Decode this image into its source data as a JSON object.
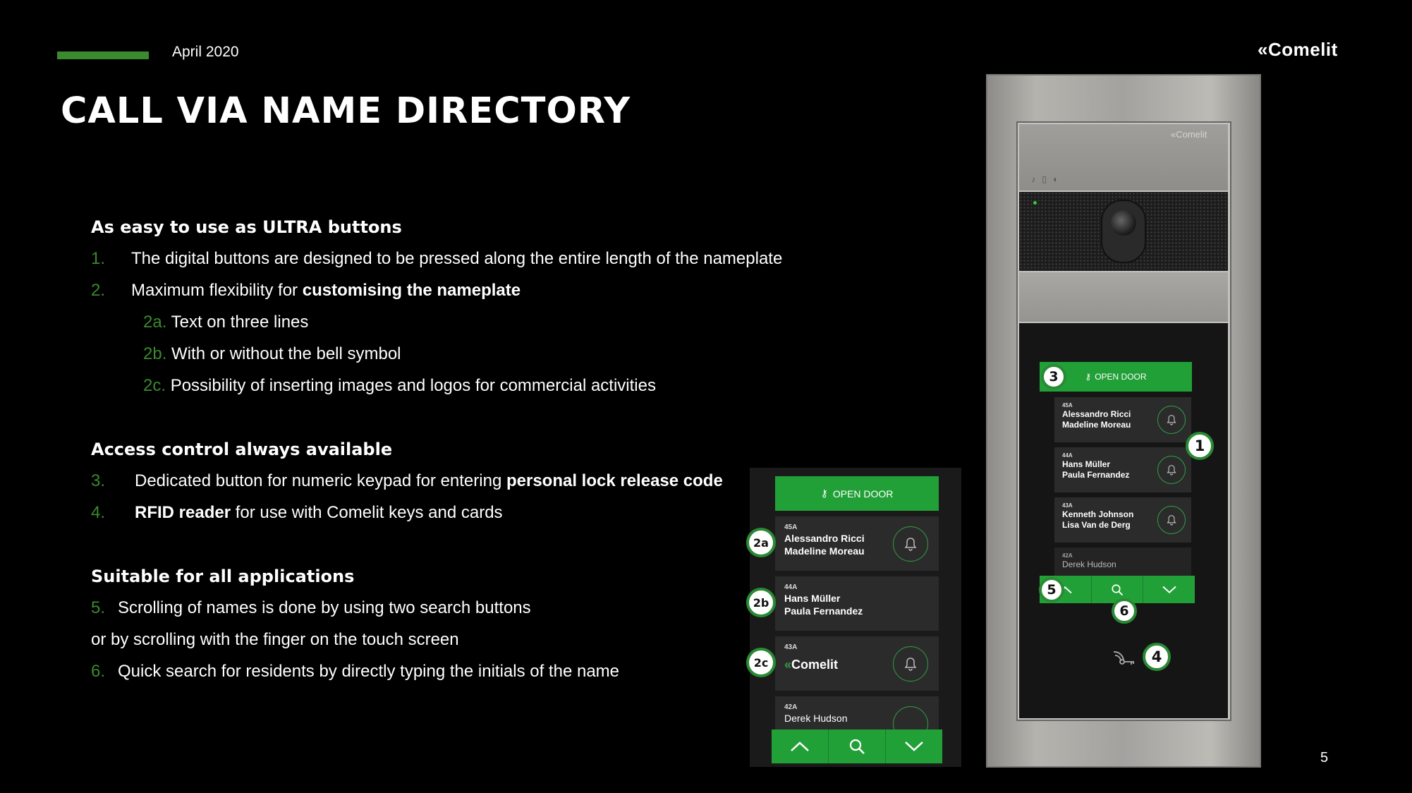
{
  "header": {
    "date": "April 2020",
    "title": "CALL VIA NAME DIRECTORY",
    "logo": "Comelit",
    "page_number": "5"
  },
  "sections": [
    {
      "heading": "As easy to use as ULTRA buttons",
      "items": [
        {
          "num": "1.",
          "text": "The digital buttons are designed to be pressed along the entire length of the nameplate",
          "bold": ""
        },
        {
          "num": "2.",
          "text": "Maximum flexibility for ",
          "bold": "customising the nameplate"
        },
        {
          "num": "2a.",
          "text": "Text on three lines",
          "bold": ""
        },
        {
          "num": "2b.",
          "text": "With or without the bell symbol",
          "bold": ""
        },
        {
          "num": "2c.",
          "text": "Possibility of inserting images and logos for commercial activities",
          "bold": ""
        }
      ]
    },
    {
      "heading": "Access control always available",
      "items": [
        {
          "num": "3.",
          "text": "Dedicated button for numeric keypad for entering ",
          "bold": "personal lock release code"
        },
        {
          "num": "4.",
          "text_pre": "",
          "bold": "RFID reader",
          "text": " for use with Comelit keys and cards"
        }
      ]
    },
    {
      "heading": "Suitable for all applications",
      "items": [
        {
          "num": "5.",
          "text": "Scrolling of names is done by using two search buttons",
          "bold": ""
        },
        {
          "num": "",
          "text": "or by scrolling with the finger on the touch screen",
          "bold": ""
        },
        {
          "num": "6.",
          "text": "Quick search for residents by directly typing the initials of the name",
          "bold": ""
        }
      ]
    }
  ],
  "panel": {
    "open_door": "OPEN DOOR",
    "entries": [
      {
        "apt": "45A",
        "line1": "Alessandro Ricci",
        "line2": "Madeline Moreau",
        "badge": "2a"
      },
      {
        "apt": "44A",
        "line1": "Hans Müller",
        "line2": "Paula Fernandez",
        "badge": "2b"
      },
      {
        "apt": "43A",
        "logo": "Comelit",
        "badge": "2c"
      },
      {
        "apt": "42A",
        "line1": "Derek Hudson"
      }
    ]
  },
  "device": {
    "brand": "Comelit",
    "open_door": "OPEN DOOR",
    "entries": [
      {
        "apt": "45A",
        "line1": "Alessandro Ricci",
        "line2": "Madeline Moreau"
      },
      {
        "apt": "44A",
        "line1": "Hans Müller",
        "line2": "Paula Fernandez"
      },
      {
        "apt": "43A",
        "line1": "Kenneth Johnson",
        "line2": "Lisa Van de Derg"
      },
      {
        "apt": "42A",
        "line1": "Derek Hudson"
      }
    ],
    "badges": [
      "1",
      "3",
      "4",
      "5",
      "6"
    ]
  },
  "colors": {
    "accent": "#3a8a2e",
    "button_green": "#22a038"
  }
}
